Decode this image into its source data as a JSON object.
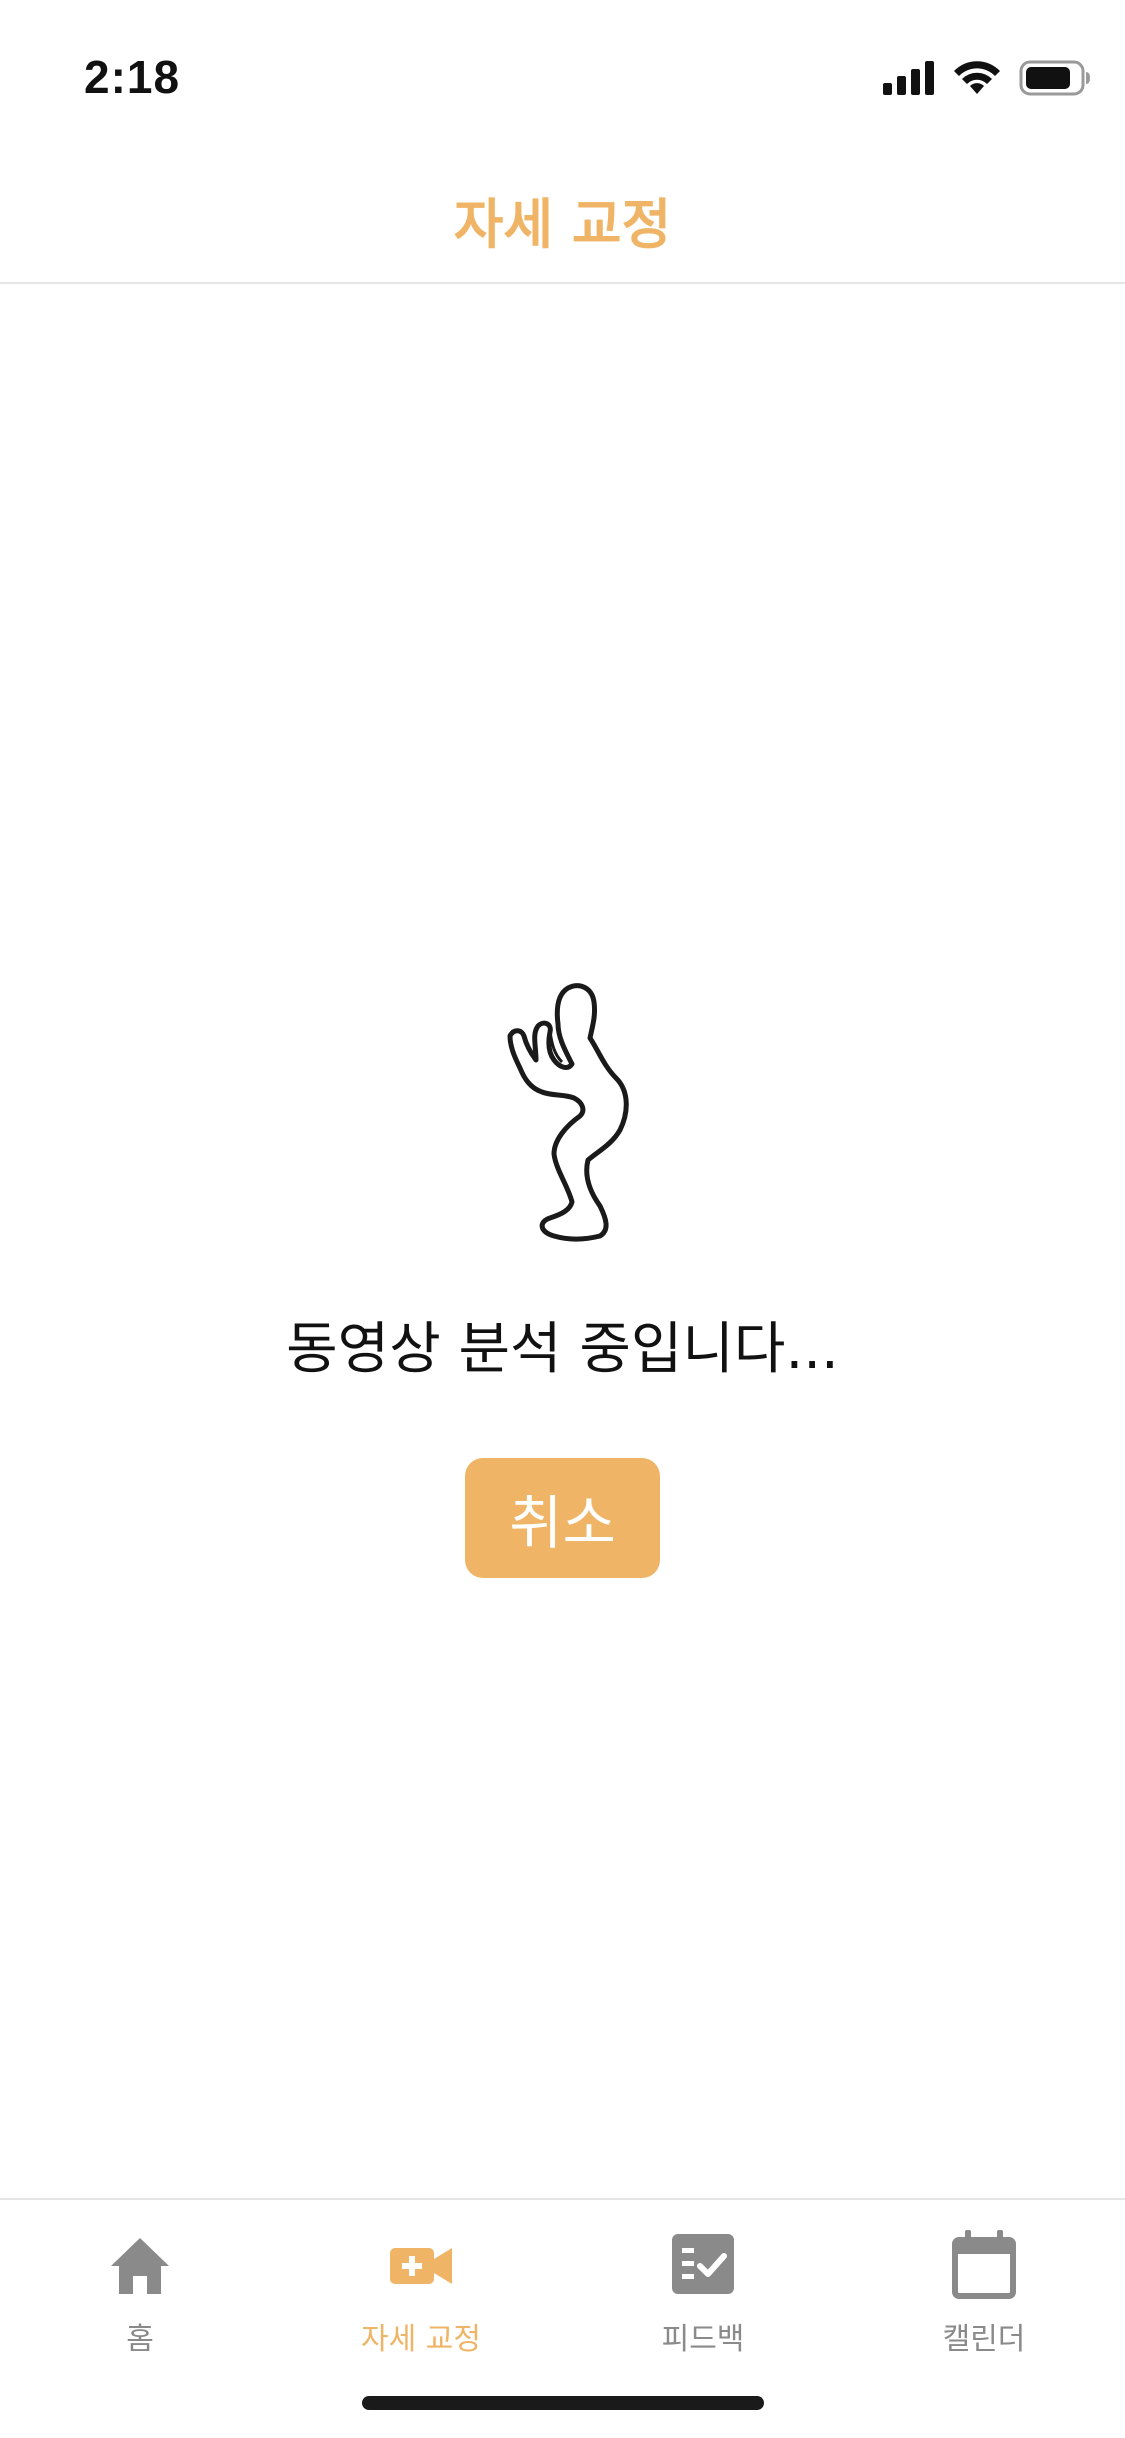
{
  "status_bar": {
    "time": "2:18",
    "icons": [
      "cellular-signal-icon",
      "wifi-icon",
      "battery-icon"
    ]
  },
  "header": {
    "title": "자세 교정"
  },
  "main": {
    "illustration": "squat-silhouette-icon",
    "status_text": "동영상 분석 중입니다...",
    "cancel_label": "취소"
  },
  "tab_bar": {
    "tabs": [
      {
        "label": "홈",
        "icon": "home-icon",
        "active": false
      },
      {
        "label": "자세 교정",
        "icon": "video-add-icon",
        "active": true
      },
      {
        "label": "피드백",
        "icon": "checklist-icon",
        "active": false
      },
      {
        "label": "캘린더",
        "icon": "calendar-icon",
        "active": false
      }
    ]
  },
  "colors": {
    "accent": "#F0B466",
    "inactive": "#8A8A8A",
    "text": "#111111",
    "divider": "#E6E6E6"
  }
}
